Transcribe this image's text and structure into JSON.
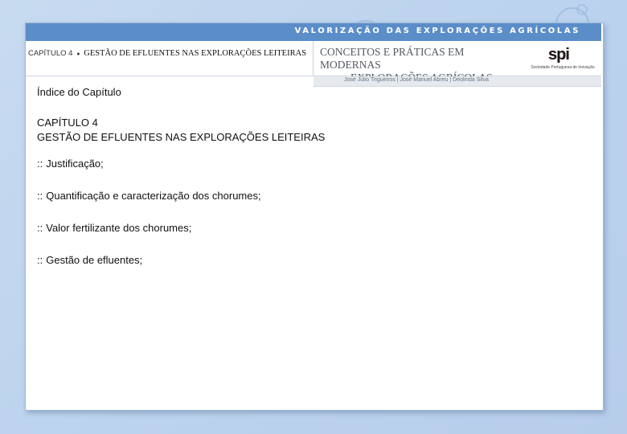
{
  "header": {
    "band_title": "VALORIZAÇÃO DAS EXPLORAÇÕES AGRÍCOLAS",
    "chapter_prefix": "CAPÍTULO 4",
    "chapter_bullet": "●",
    "chapter_title": "GESTÃO DE EFLUENTES NAS EXPLORAÇÕES LEITEIRAS",
    "book_title_line1": "CONCEITOS E PRÁTICAS EM MODERNAS",
    "book_title_line2": "EXPLORAÇÕES AGRÍCOLAS",
    "logo_mark": "spi",
    "logo_caption": "Sociedade Portuguesa de Inovação",
    "authors": "José Júlio Trigueiros | José Manuel Abreu | Deolinda Silva"
  },
  "content": {
    "index_title": "Índice do Capítulo",
    "chapter_label": "CAPÍTULO 4",
    "chapter_subtitle": "GESTÃO DE EFLUENTES NAS EXPLORAÇÕES LEITEIRAS",
    "bullet_marker": "::",
    "items": [
      {
        "label": "Justificação;"
      },
      {
        "label": "Quantificação e caracterização dos chorumes;"
      },
      {
        "label": "Valor fertilizante dos chorumes;"
      },
      {
        "label": "Gestão de efluentes;"
      }
    ]
  },
  "colors": {
    "band": "#5b8dc9",
    "background": "#c7daf0",
    "logo_accent": "#c0292c"
  }
}
